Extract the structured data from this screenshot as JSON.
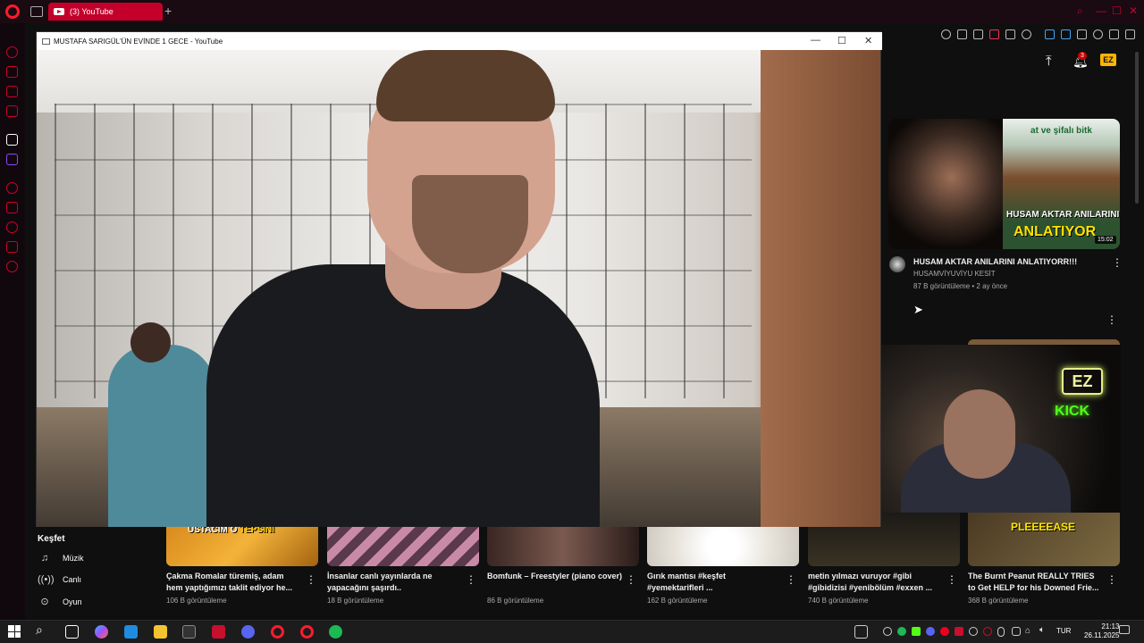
{
  "browser": {
    "tab_title": "(3) YouTube",
    "new_tab_symbol": "+"
  },
  "popup": {
    "title": "MUSTAFA SARIGÜL'ÜN EVİNDE 1 GECE - YouTube",
    "minimize": "—",
    "maximize": "☐",
    "close": "✕"
  },
  "header": {
    "notification_count": "3",
    "avatar_text": "EZ"
  },
  "recommendation": {
    "title": "HUSAM AKTAR ANILARINI ANLATIYORR!!!",
    "channel": "HUSAMVİYUVİYU KESİT",
    "meta": "87 B görüntüleme • 2 ay önce",
    "duration": "15:02",
    "thumb_top_text": "at ve şifalı bitk",
    "thumb_line1": "HUSAM AKTAR ANILARINI",
    "thumb_line2": "ANLATIYOR"
  },
  "webcam": {
    "logo_text": "EZ",
    "kick_text": "KICK"
  },
  "explore": {
    "heading": "Keşfet",
    "items": [
      {
        "label": "Müzik",
        "icon": "music-note-icon"
      },
      {
        "label": "Canlı",
        "icon": "live-icon"
      },
      {
        "label": "Oyun",
        "icon": "gamepad-icon"
      }
    ]
  },
  "bottom_videos": [
    {
      "title": "Çakma Romalar türemiş, adam hem yaptığımızı taklit ediyor he...",
      "views": "106 B görüntüleme",
      "overlay_white": "USTACIM O ",
      "overlay_yellow": "TEPSİNİ"
    },
    {
      "title": "İnsanlar canlı yayınlarda ne yapacağını şaşırdı..",
      "views": "18 B görüntüleme"
    },
    {
      "title": "Bomfunk – Freestyler (piano cover)",
      "views": "86 B görüntüleme"
    },
    {
      "title": "Gırık mantısı #keşfet #yemektarifleri ...",
      "views": "162 B görüntüleme"
    },
    {
      "title": "metin yılmazı vuruyor #gibi #gibidizisi #yenibölüm #exxen ...",
      "views": "740 B görüntüleme"
    },
    {
      "title": "The Burnt Peanut REALLY TRIES to Get HELP for his Downed Frie...",
      "views": "368 B görüntüleme",
      "overlay": "PLEEEEASE"
    }
  ],
  "taskbar": {
    "language": "TUR",
    "time": "21:13",
    "date": "26.11.2025"
  },
  "colors": {
    "opera_red": "#ff1b2d",
    "tab_red": "#c4002a",
    "kick_green": "#53fc18",
    "thumb_yellow": "#ffe100"
  }
}
